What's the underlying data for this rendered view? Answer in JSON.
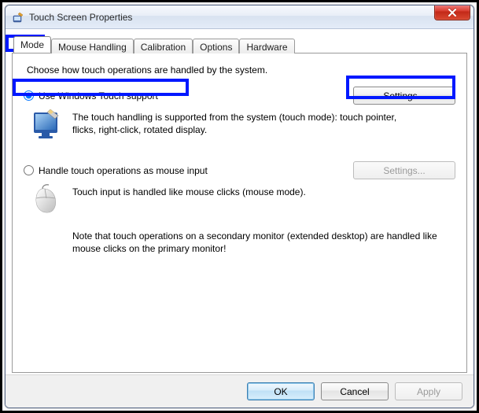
{
  "window": {
    "title": "Touch Screen Properties"
  },
  "tabs": {
    "t0": "Mode",
    "t1": "Mouse Handling",
    "t2": "Calibration",
    "t3": "Options",
    "t4": "Hardware"
  },
  "panel": {
    "intro": "Choose how touch operations are handled by the system.",
    "opt1": {
      "label": "Use Windows Touch support",
      "settings": "Settings...",
      "desc": "The touch handling is supported from the system (touch mode): touch pointer, flicks, right-click, rotated display."
    },
    "opt2": {
      "label": "Handle touch operations as mouse input",
      "settings": "Settings...",
      "desc": "Touch input is handled like mouse clicks (mouse mode).",
      "note": "Note that touch operations on a secondary monitor (extended desktop) are handled like mouse clicks on the primary monitor!"
    }
  },
  "buttons": {
    "ok": "OK",
    "cancel": "Cancel",
    "apply": "Apply"
  }
}
